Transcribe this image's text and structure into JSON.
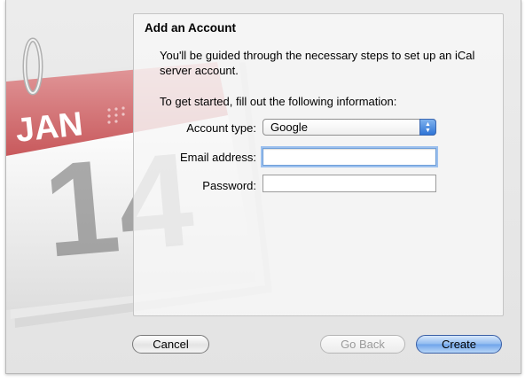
{
  "calendar_icon": {
    "month": "JAN",
    "day": "14"
  },
  "panel": {
    "title": "Add an Account",
    "intro": "You'll be guided through the necessary steps to set up an iCal server account.",
    "instruction": "To get started, fill out the following information:"
  },
  "form": {
    "account_type_label": "Account type:",
    "account_type_value": "Google",
    "email_label": "Email address:",
    "email_value": "",
    "password_label": "Password:",
    "password_value": ""
  },
  "buttons": {
    "cancel": "Cancel",
    "go_back": "Go Back",
    "create": "Create"
  },
  "colors": {
    "calendar_red": "#c8595c",
    "focus_ring": "#9cc0ee",
    "default_button": "#6ea3ea"
  }
}
